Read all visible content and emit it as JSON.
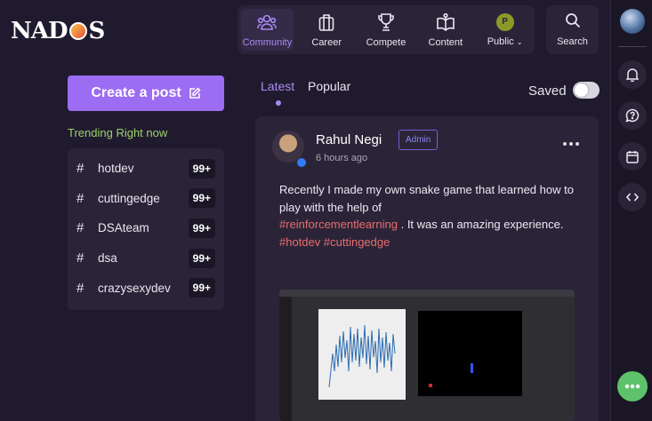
{
  "logo": {
    "text_left": "NAD",
    "text_right": "S"
  },
  "topnav": {
    "items": [
      {
        "label": "Community",
        "icon": "community-icon",
        "active": true
      },
      {
        "label": "Career",
        "icon": "briefcase-icon"
      },
      {
        "label": "Compete",
        "icon": "trophy-icon"
      },
      {
        "label": "Content",
        "icon": "book-icon"
      },
      {
        "label": "Public",
        "icon": "avatar",
        "avatar_letter": "P"
      }
    ],
    "search_label": "Search"
  },
  "sidebar": {
    "create_post_label": "Create a post",
    "trending_title": "Trending Right now",
    "trending": [
      {
        "hash": "#",
        "name": "hotdev",
        "count": "99+"
      },
      {
        "hash": "#",
        "name": "cuttingedge",
        "count": "99+"
      },
      {
        "hash": "#",
        "name": "DSAteam",
        "count": "99+"
      },
      {
        "hash": "#",
        "name": "dsa",
        "count": "99+"
      },
      {
        "hash": "#",
        "name": "crazysexydev",
        "count": "99+"
      }
    ]
  },
  "feed": {
    "tabs": [
      {
        "label": "Latest"
      },
      {
        "label": "Popular"
      }
    ],
    "saved_label": "Saved"
  },
  "post": {
    "author": "Rahul Negi",
    "badge": "Admin",
    "time": "6 hours ago",
    "text_1": "Recently I made my own snake game that learned how to play with the help of",
    "hashtag_inline": "#reinforcementlearning",
    "text_2": ". It was an amazing experience.",
    "hashtags": [
      "#hotdev",
      "#cuttingedge"
    ]
  },
  "colors": {
    "accent": "#9c6cf2",
    "trending": "#9bd36a",
    "hashtag": "#e86d6d",
    "chat": "#5ec26a"
  }
}
